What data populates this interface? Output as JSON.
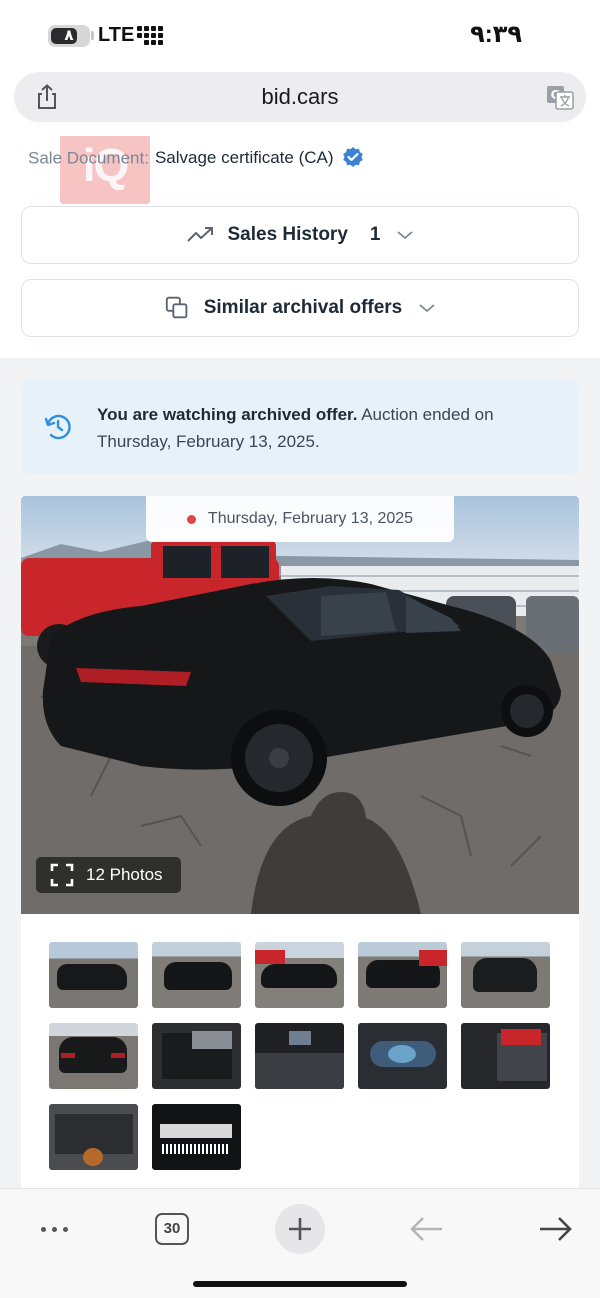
{
  "status_bar": {
    "battery_level": "٨",
    "carrier": "LTE",
    "time": "٩:٣٩",
    "battery_icon": "battery-icon",
    "signal_icon": "signal-bars-icon"
  },
  "address_bar": {
    "url": "bid.cars",
    "share_icon": "share-icon",
    "translate_icon": "translate-icon"
  },
  "sale_document": {
    "label": "Sale Document:",
    "value": "Salvage certificate (CA)",
    "verified_icon": "verified-badge-icon",
    "watermark": "iQ"
  },
  "sales_history": {
    "label": "Sales History",
    "count": "1",
    "icon": "trending-up-icon"
  },
  "similar_offers": {
    "label": "Similar archival offers",
    "icon": "copy-icon"
  },
  "notice": {
    "bold": "You are watching archived offer.",
    "rest": " Auction ended on Thursday, February 13, 2025.",
    "icon": "history-icon"
  },
  "gallery": {
    "date": "Thursday, February 13, 2025",
    "photos_label": "12 Photos",
    "thumbnail_count": 12
  },
  "toolbar": {
    "tabs_count": "30",
    "more_icon": "more-dots-icon",
    "new_tab_icon": "plus-icon",
    "back_icon": "back-arrow-icon",
    "forward_icon": "forward-arrow-icon"
  },
  "colors": {
    "accent_blue": "#3b82d6",
    "notice_bg": "#e6f1fa",
    "date_dot": "#e04444"
  }
}
